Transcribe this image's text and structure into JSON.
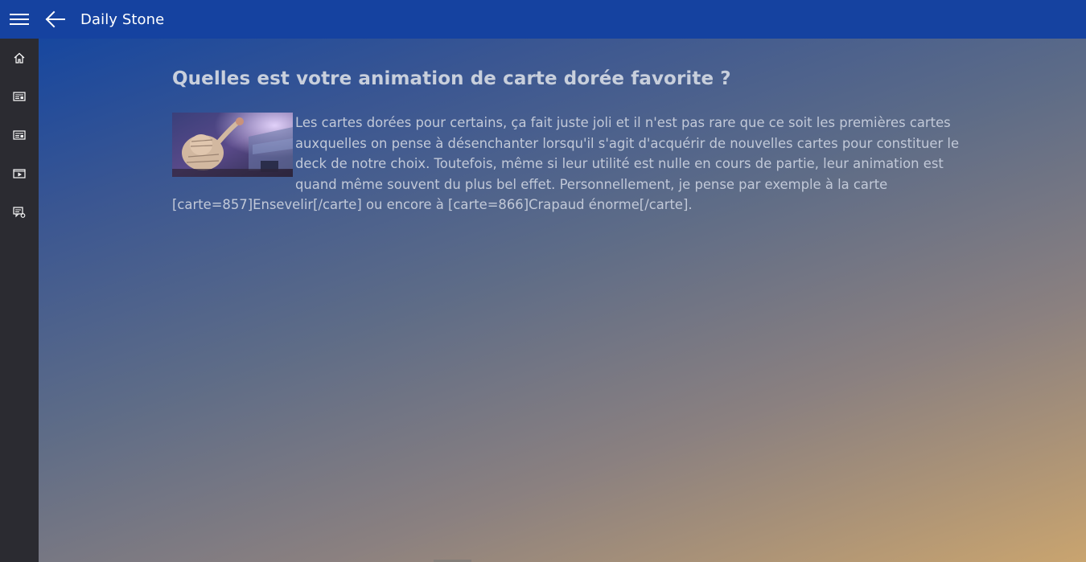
{
  "app": {
    "title": "Daily Stone"
  },
  "icons": {
    "menu": "hamburger-icon",
    "back": "back-arrow-icon",
    "home": "home-icon",
    "news": "news-icon",
    "articles": "articles-icon",
    "videos": "video-icon",
    "forum": "forum-icon"
  },
  "sidebar": {
    "items": [
      {
        "name": "home",
        "icon": "home-icon"
      },
      {
        "name": "news",
        "icon": "news-icon"
      },
      {
        "name": "articles",
        "icon": "articles-icon"
      },
      {
        "name": "videos",
        "icon": "video-icon"
      },
      {
        "name": "forum",
        "icon": "forum-icon"
      }
    ]
  },
  "article": {
    "title": "Quelles est votre animation de carte dorée favorite ?",
    "body": "Les cartes dorées pour certains, ça fait juste joli et il n'est pas rare que ce soit les premières cartes auxquelles on pense à désenchanter lorsqu'il s'agit d'acquérir de nouvelles cartes pour constituer le deck de notre choix. Toutefois, même si leur utilité est nulle en cours de partie, leur animation est quand même souvent du plus bel effet. Personnellement, je pense par exemple à la carte [carte=857]Ensevelir[/carte] ou encore à [carte=866]Crapaud énorme[/carte]."
  },
  "colors": {
    "topbar": "#1542a0",
    "sidebar": "#2b2b31",
    "text": "#c2c9d8"
  }
}
